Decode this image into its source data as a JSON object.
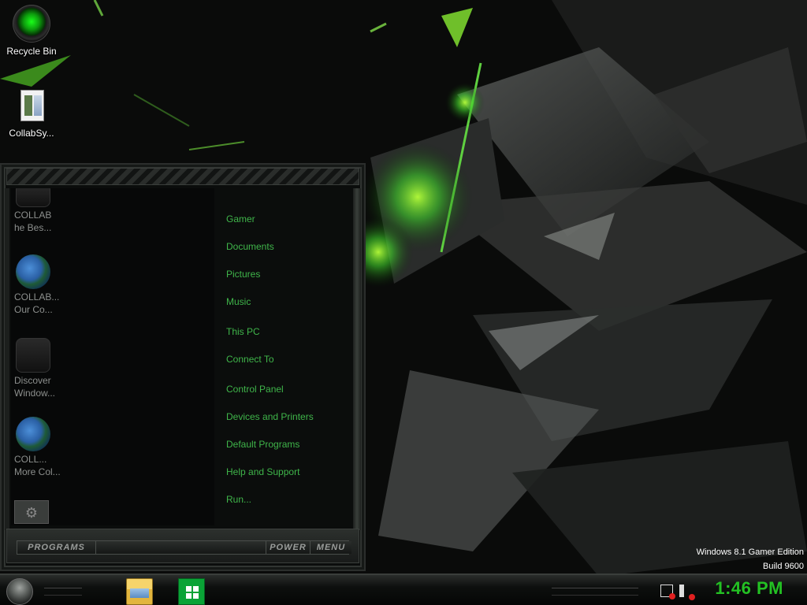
{
  "desktop": {
    "icons": [
      {
        "label": "Recycle Bin",
        "icon": "recycle-bin-icon"
      },
      {
        "label": "CollabSy...",
        "icon": "document-icon"
      }
    ],
    "watermark": {
      "line1": "Windows 8.1 Gamer Edition",
      "line2": "Build 9600"
    }
  },
  "start_menu": {
    "programs": [
      {
        "line1": "COLLAB",
        "line2": "he Bes...",
        "icon": "app-icon"
      },
      {
        "line1": "COLLAB...",
        "line2": "Our Co...",
        "icon": "globe-icon"
      },
      {
        "line1": "Discover",
        "line2": "Window...",
        "icon": "app-icon"
      },
      {
        "line1": "COLL...",
        "line2": "More Col...",
        "icon": "globe-icon"
      }
    ],
    "links": [
      "Gamer",
      "Documents",
      "Pictures",
      "Music",
      "This PC",
      "Connect To",
      "Control Panel",
      "Devices and Printers",
      "Default Programs",
      "Help and Support",
      "Run..."
    ],
    "bottom": {
      "programs_label": "PROGRAMS",
      "power_label": "POWER",
      "menu_label": "MENU"
    }
  },
  "taskbar": {
    "apps": [
      {
        "name": "File Explorer",
        "icon": "file-explorer-icon"
      },
      {
        "name": "Store",
        "icon": "store-icon"
      }
    ],
    "tray": [
      {
        "icon": "network-error-icon"
      },
      {
        "icon": "volume-muted-icon"
      }
    ],
    "clock": "1:46 PM"
  },
  "colors": {
    "accent": "#3fb54a",
    "clock": "#23c123"
  }
}
